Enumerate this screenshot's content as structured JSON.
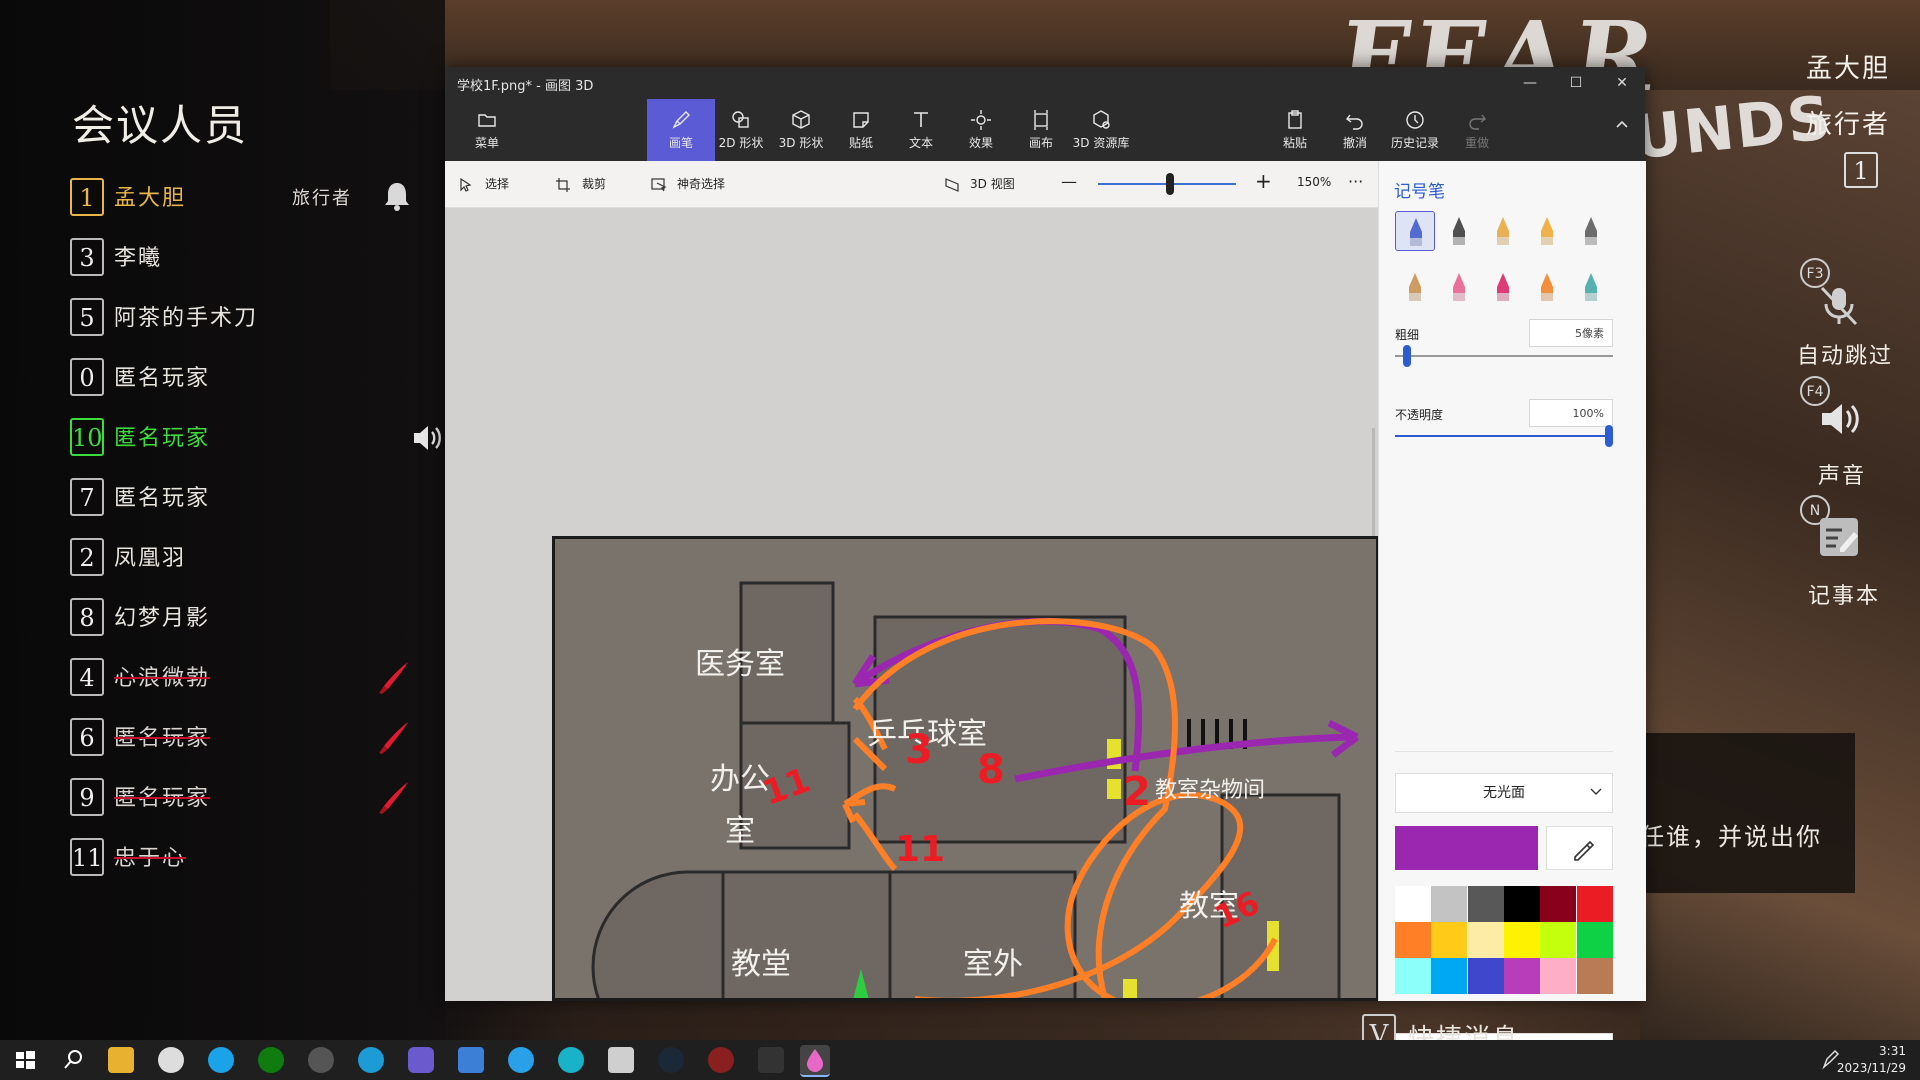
{
  "meeting": {
    "title": "会议人员",
    "players": [
      {
        "num": "1",
        "name": "孟大胆",
        "role": "旅行者",
        "state": "me",
        "icon": "bell-icon"
      },
      {
        "num": "3",
        "name": "李曦",
        "state": "normal"
      },
      {
        "num": "5",
        "name": "阿茶的手术刀",
        "state": "normal"
      },
      {
        "num": "0",
        "name": "匿名玩家",
        "state": "normal"
      },
      {
        "num": "10",
        "name": "匿名玩家",
        "state": "active",
        "icon": "speaker-icon"
      },
      {
        "num": "7",
        "name": "匿名玩家",
        "state": "normal"
      },
      {
        "num": "2",
        "name": "凤凰羽",
        "state": "normal"
      },
      {
        "num": "8",
        "name": "幻梦月影",
        "state": "normal"
      },
      {
        "num": "4",
        "name": "心浪微勃",
        "state": "dead",
        "icon": "knife-icon"
      },
      {
        "num": "6",
        "name": "匿名玩家",
        "state": "dead",
        "icon": "knife-icon"
      },
      {
        "num": "9",
        "name": "匿名玩家",
        "state": "dead",
        "icon": "knife-icon"
      },
      {
        "num": "11",
        "name": "忠于心",
        "state": "dead"
      }
    ]
  },
  "hud": {
    "player_name": "孟大胆",
    "player_role": "旅行者",
    "player_num": "1",
    "auto_skip_key": "F3",
    "auto_skip_label": "自动跳过",
    "sound_key": "F4",
    "sound_label": "声音",
    "notebook_key": "N",
    "notebook_label": "记事本",
    "subtitle": "任谁，并说出你",
    "quick_msg_key": "V",
    "quick_msg_label": "快捷消息",
    "logo_text": "FEAR",
    "logo_sub": "OUNDS"
  },
  "paint": {
    "window_title": "学校1F.png* - 画图 3D",
    "window_controls": {
      "minimize": "—",
      "maximize": "☐",
      "close": "✕"
    },
    "ribbon": [
      {
        "label": "菜单",
        "icon": "folder-icon"
      },
      {
        "label": "画笔",
        "icon": "brush-icon",
        "selected": true
      },
      {
        "label": "2D 形状",
        "icon": "shapes-2d-icon"
      },
      {
        "label": "3D 形状",
        "icon": "cube-icon"
      },
      {
        "label": "贴纸",
        "icon": "sticker-icon"
      },
      {
        "label": "文本",
        "icon": "text-icon"
      },
      {
        "label": "效果",
        "icon": "effects-icon"
      },
      {
        "label": "画布",
        "icon": "canvas-icon"
      },
      {
        "label": "3D 资源库",
        "icon": "library-icon"
      },
      {
        "label": "粘贴",
        "icon": "paste-icon"
      },
      {
        "label": "撤消",
        "icon": "undo-icon"
      },
      {
        "label": "历史记录",
        "icon": "history-icon"
      },
      {
        "label": "重做",
        "icon": "redo-icon",
        "disabled": true
      }
    ],
    "toolbar": {
      "select": "选择",
      "crop": "裁剪",
      "magic_select": "神奇选择",
      "view_3d": "3D 视图",
      "zoom_minus": "—",
      "zoom_plus": "+",
      "zoom_percent": "150%",
      "more": "···",
      "zoom_level": 0.52
    },
    "panel": {
      "title": "记号笔",
      "thickness_label": "粗细",
      "thickness_value": "5像素",
      "thickness_level": 0.04,
      "opacity_label": "不透明度",
      "opacity_value": "100%",
      "opacity_level": 1.0,
      "finish": "无光面",
      "add_color": "添加颜色",
      "current_color": "#9b27b0",
      "palette": [
        "#ffffff",
        "#c3c3c3",
        "#585858",
        "#000000",
        "#88001b",
        "#ec1c24",
        "#ff7f27",
        "#ffca18",
        "#fdeca6",
        "#fff200",
        "#c4ff0e",
        "#0ed145",
        "#8cfffb",
        "#00a8f3",
        "#3f48cc",
        "#b83dba",
        "#ffaec8",
        "#b97a56"
      ]
    },
    "map_labels": {
      "medical": "医务室",
      "pingpong": "乒乓球室",
      "office_a": "办公",
      "office_b": "室",
      "storage": "教室杂物间",
      "classroom": "教室",
      "church": "教堂",
      "outdoor": "室外"
    },
    "map_marks": {
      "m1": "11",
      "m2": "3",
      "m3": "8",
      "m4": "2",
      "m5": "11",
      "m6": "16"
    }
  },
  "taskbar": {
    "time": "3:31",
    "date": "2023/11/29"
  }
}
